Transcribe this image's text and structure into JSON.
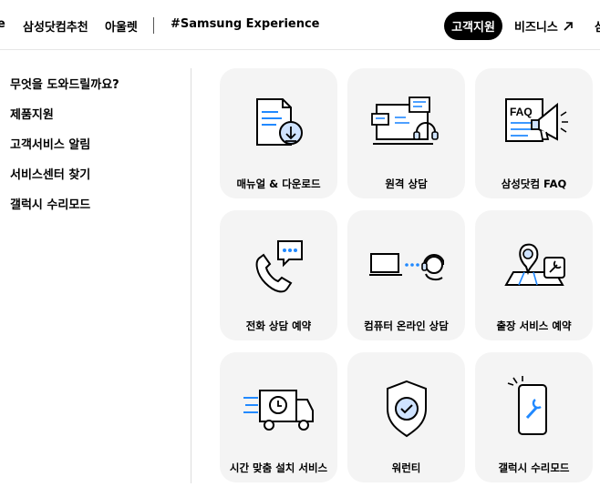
{
  "nav": {
    "items": [
      "삼성닷컴추천",
      "아울렛",
      "#Samsung Experience",
      "비즈니스"
    ],
    "active": "고객지원",
    "cut_left": "e",
    "cut_right": "삼"
  },
  "sidemenu": {
    "items": [
      "무엇을 도와드릴까요?",
      "제품지원",
      "고객서비스 알림",
      "서비스센터 찾기",
      "갤럭시 수리모드"
    ]
  },
  "cards": [
    {
      "label": "매뉴얼 & 다운로드",
      "icon": "manual-download-icon"
    },
    {
      "label": "원격 상담",
      "icon": "remote-consult-icon"
    },
    {
      "label": "삼성닷컴 FAQ",
      "icon": "faq-megaphone-icon",
      "icon_text": "FAQ"
    },
    {
      "label": "전화 상담 예약",
      "icon": "phone-chat-icon"
    },
    {
      "label": "컴퓨터 온라인 상담",
      "icon": "computer-headset-icon"
    },
    {
      "label": "출장 서비스 예약",
      "icon": "map-wrench-icon"
    },
    {
      "label": "시간 맞춤 설치 서비스",
      "icon": "delivery-truck-icon"
    },
    {
      "label": "워런티",
      "icon": "shield-check-icon"
    },
    {
      "label": "갤럭시 수리모드",
      "icon": "phone-repair-icon"
    }
  ],
  "colors": {
    "accent": "#2189ff",
    "ink": "#000000",
    "card_bg": "#f4f4f4"
  }
}
